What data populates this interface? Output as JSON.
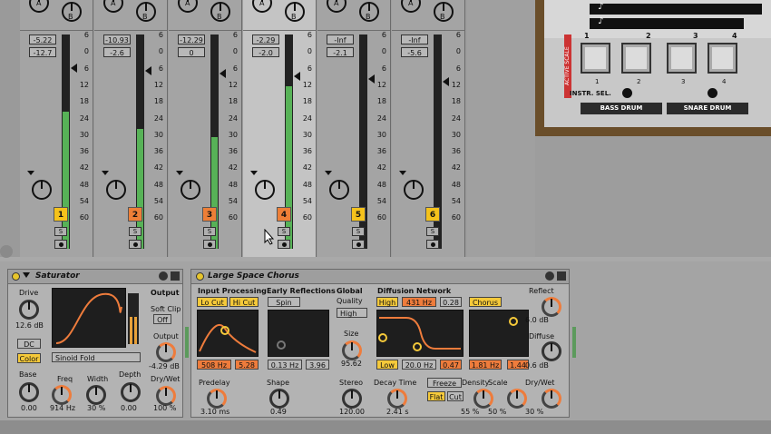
{
  "mixer": {
    "knob_labels": [
      "A",
      "B"
    ],
    "tracks": [
      {
        "number": "1",
        "color": "#f5c21b",
        "peak": "-5.22",
        "volume": "-12.7",
        "level": 0.64
      },
      {
        "number": "2",
        "color": "#ee7f37",
        "peak": "-10.93",
        "volume": "-2.6",
        "level": 0.56
      },
      {
        "number": "3",
        "color": "#ee7f37",
        "peak": "-12.29",
        "volume": "0",
        "level": 0.52
      },
      {
        "number": "4",
        "color": "#ee7f37",
        "peak": "-2.29",
        "volume": "-2.0",
        "level": 0.76
      },
      {
        "number": "5",
        "color": "#f5c21b",
        "peak": "-Inf",
        "volume": "-2.1",
        "level": 0
      },
      {
        "number": "6",
        "color": "#f5c21b",
        "peak": "-Inf",
        "volume": "-5.6",
        "level": 0
      }
    ],
    "scale": [
      "6",
      "0",
      "6",
      "12",
      "18",
      "24",
      "30",
      "36",
      "42",
      "48",
      "54",
      "60"
    ],
    "solo_label": "S"
  },
  "drum_machine": {
    "side_label": "ACTIVE SCALE",
    "pad_numbers": [
      "1",
      "2",
      "3",
      "4"
    ],
    "pad_sub_numbers": [
      "1",
      "2",
      "3",
      "4"
    ],
    "instr_sel": "INSTR. SEL.",
    "labels": [
      "BASS DRUM",
      "SNARE DRUM"
    ]
  },
  "saturator": {
    "title": "Saturator",
    "drive_label": "Drive",
    "drive_value": "12.6 dB",
    "dc_label": "DC",
    "color_label": "Color",
    "curve_select": "Sinoid Fold",
    "output_label": "Output",
    "soft_clip_label": "Soft Clip",
    "soft_clip_value": "Off",
    "output_knob_label": "Output",
    "output_value": "-4.29 dB",
    "drywet_label": "Dry/Wet",
    "drywet_value": "100 %",
    "base_label": "Base",
    "base_value": "0.00",
    "freq_label": "Freq",
    "freq_value": "914 Hz",
    "width_label": "Width",
    "width_value": "30 %",
    "depth_label": "Depth",
    "depth_value": "0.00"
  },
  "reverb": {
    "title": "Large Space Chorus",
    "input_processing": "Input Processing",
    "lo_cut": "Lo Cut",
    "hi_cut": "Hi Cut",
    "ip_freq": "508 Hz",
    "ip_q": "5.28",
    "predelay_label": "Predelay",
    "predelay_value": "3.10 ms",
    "early_reflections": "Early Reflections",
    "spin": "Spin",
    "er_freq": "0.13 Hz",
    "er_amount": "3.96",
    "shape_label": "Shape",
    "shape_value": "0.49",
    "global": "Global",
    "quality_label": "Quality",
    "quality_value": "High",
    "size_label": "Size",
    "size_value": "95.62",
    "stereo_label": "Stereo",
    "stereo_value": "120.00",
    "diffusion_network": "Diffusion Network",
    "high_label": "High",
    "high_freq": "431 Hz",
    "high_q": "0.28",
    "chorus_label": "Chorus",
    "low_label": "Low",
    "low_freq": "20.0 Hz",
    "low_q": "0.47",
    "chorus_freq": "1.81 Hz",
    "chorus_amount": "1.44",
    "decay_label": "Decay Time",
    "decay_value": "2.41 s",
    "freeze_label": "Freeze",
    "flat_label": "Flat",
    "cut_label": "Cut",
    "density_label": "Density",
    "density_value": "55 %",
    "scale_label": "Scale",
    "scale_value": "50 %",
    "reflect_label": "Reflect",
    "reflect_value": "6.0 dB",
    "diffuse_label": "Diffuse",
    "diffuse_value": "0.6 dB",
    "drywet_label": "Dry/Wet",
    "drywet_value": "30 %"
  }
}
